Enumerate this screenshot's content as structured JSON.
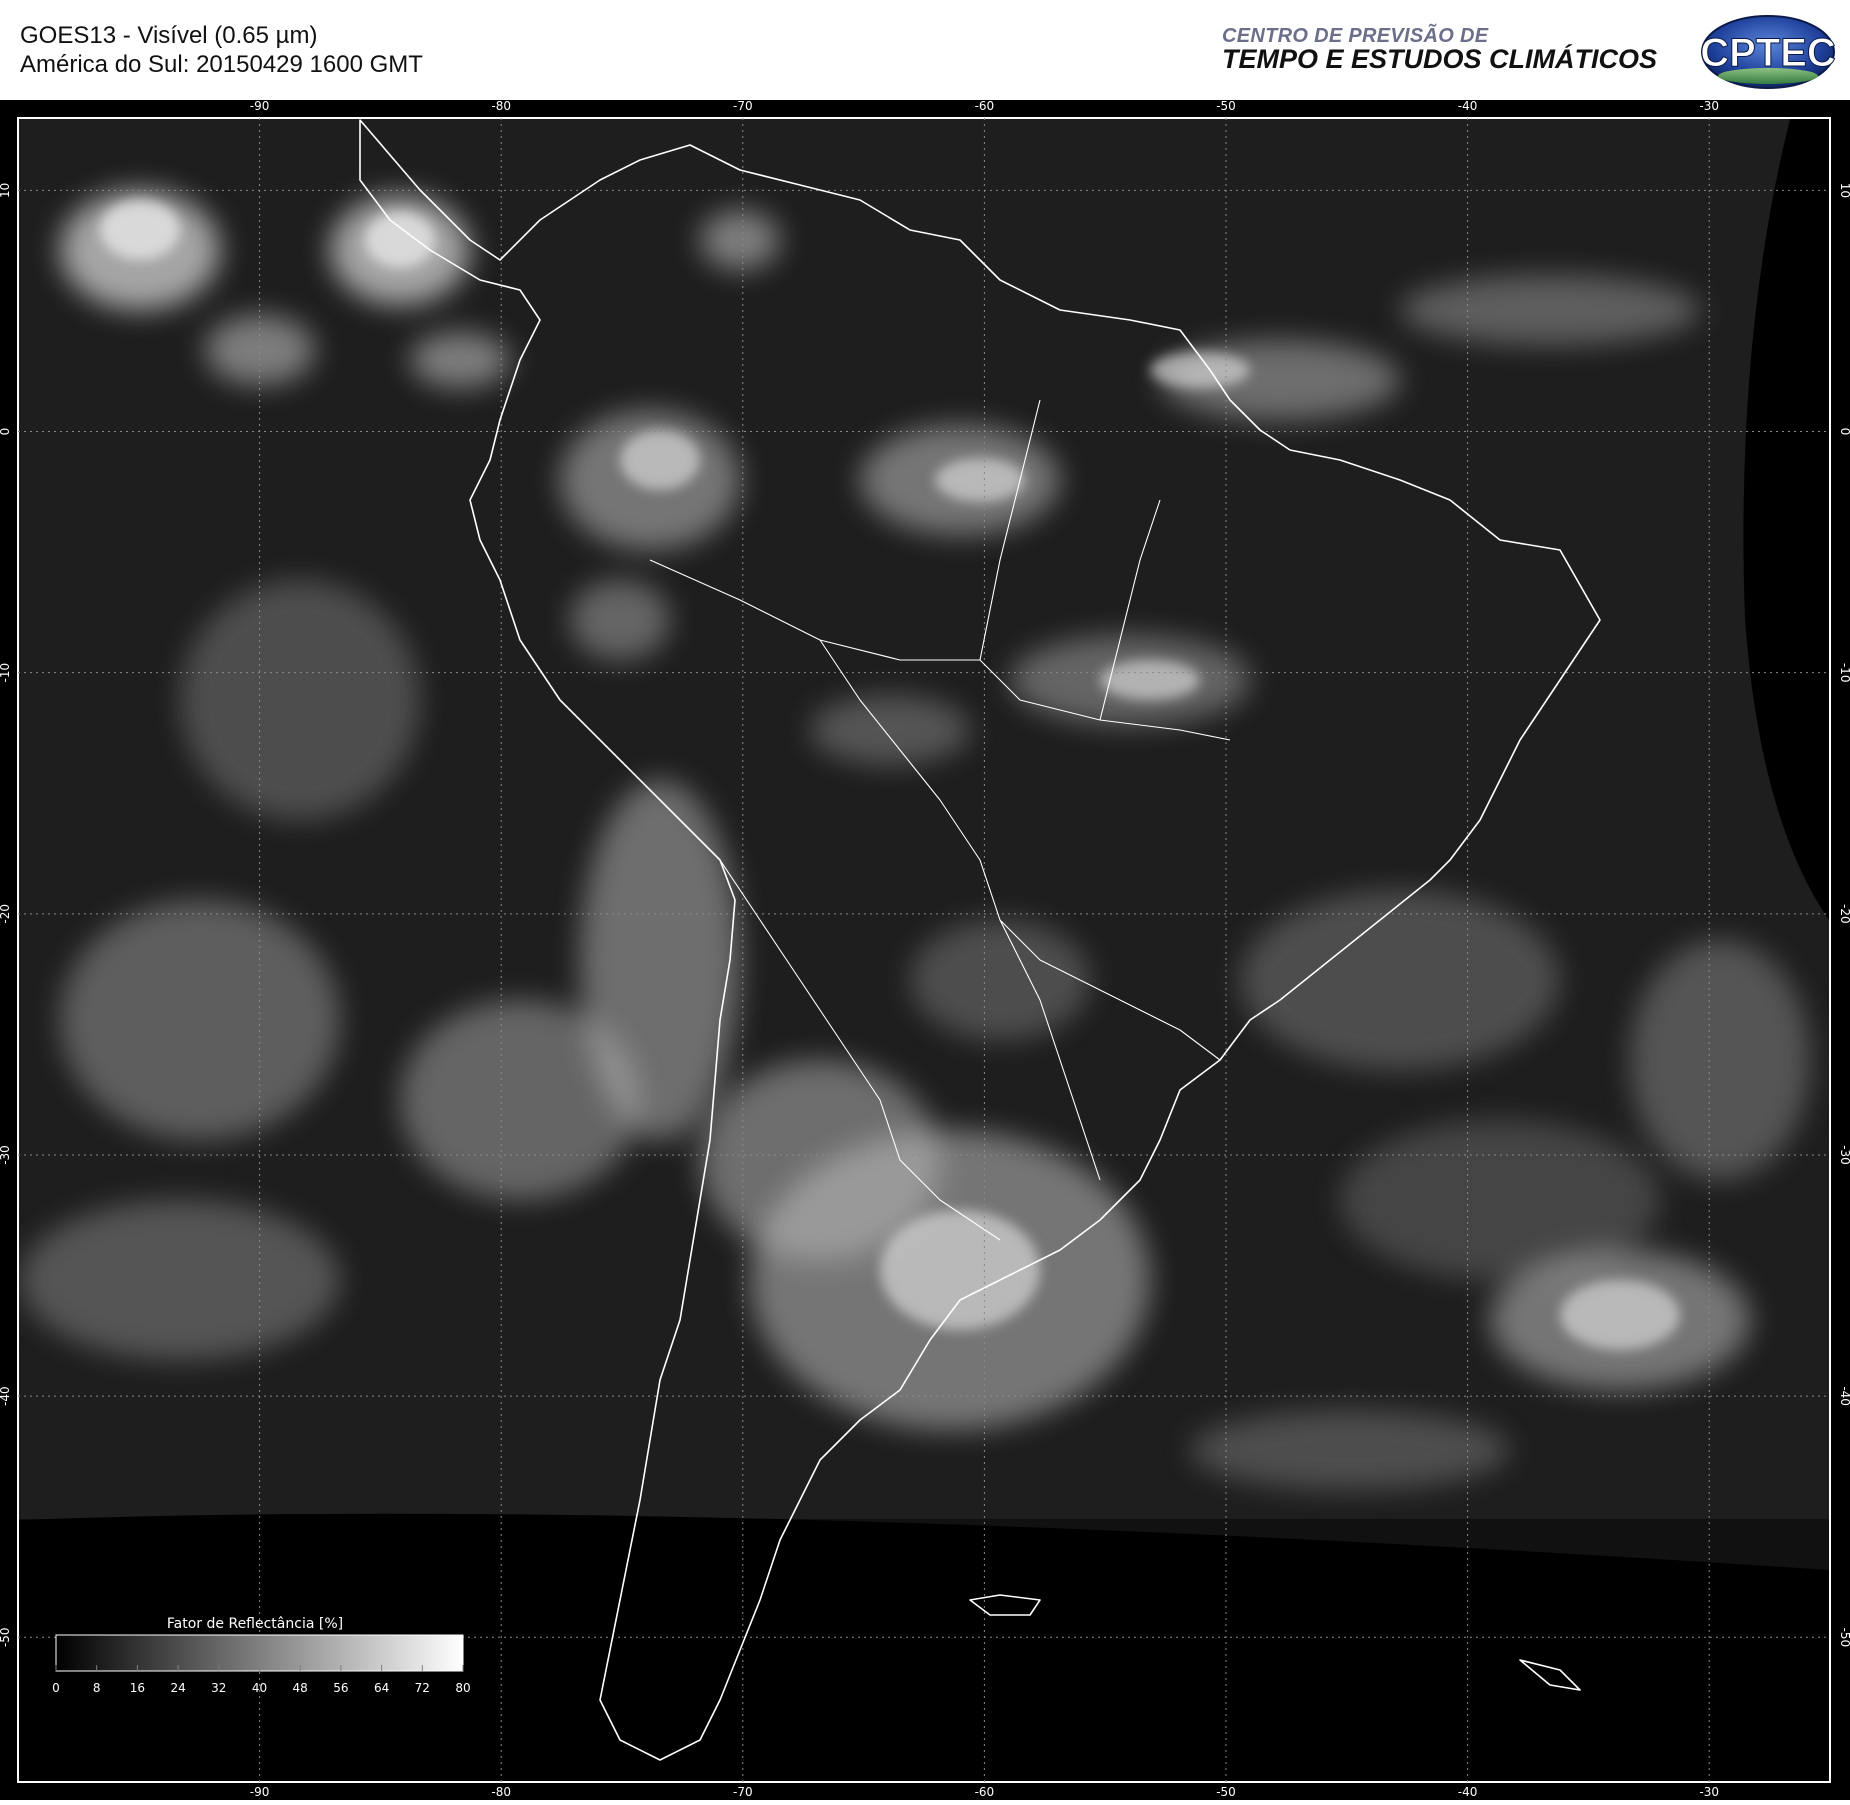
{
  "header": {
    "title_line1": "GOES13 - Visível (0.65 µm)",
    "title_line2": "América do Sul: 20150429 1600 GMT",
    "org_line1": "CENTRO DE PREVISÃO DE",
    "org_line2": "TEMPO E ESTUDOS CLIMÁTICOS",
    "logo_text": "CPTEC"
  },
  "map": {
    "lon_ticks": [
      "-90",
      "-80",
      "-70",
      "-60",
      "-50",
      "-40",
      "-30"
    ],
    "lat_ticks": [
      "10",
      "0",
      "-10",
      "-20",
      "-30",
      "-40",
      "-50"
    ],
    "lon_range": [
      -100,
      -25
    ],
    "lat_range": [
      13,
      -56
    ]
  },
  "colorbar": {
    "title": "Fator de Reflectância [%]",
    "ticks": [
      "0",
      "8",
      "16",
      "24",
      "32",
      "40",
      "48",
      "56",
      "64",
      "72",
      "80"
    ],
    "range": [
      0,
      80
    ]
  },
  "colors": {
    "frame": "#000000",
    "grid": "#8a8a8a",
    "coastline": "#ffffff",
    "org_line1": "#6b6f8a",
    "org_line2": "#111111",
    "logo_blue": "#1e3f9a"
  }
}
